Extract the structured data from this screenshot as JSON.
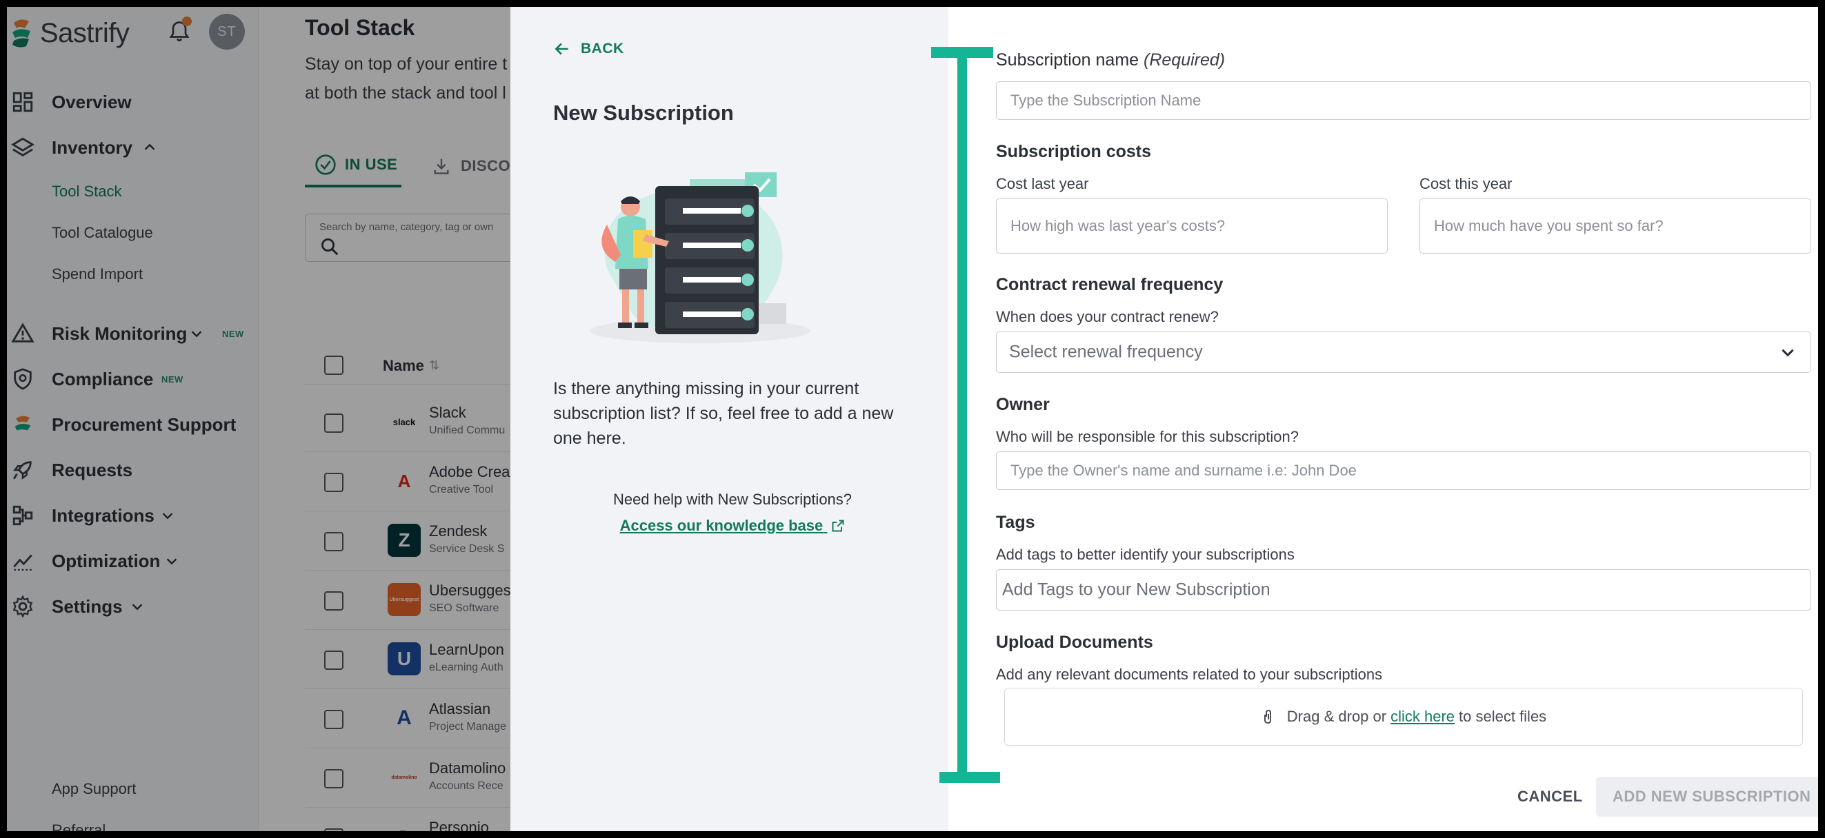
{
  "brand": {
    "name": "Sastrify"
  },
  "user": {
    "initials": "ST"
  },
  "sidebar": {
    "items": [
      {
        "label": "Overview",
        "icon": "dashboard-icon"
      },
      {
        "label": "Inventory",
        "icon": "layers-icon",
        "expanded": true
      },
      {
        "label": "Risk Monitoring",
        "icon": "warning-icon",
        "badge": "NEW"
      },
      {
        "label": "Compliance",
        "icon": "shield-icon",
        "badge": "NEW"
      },
      {
        "label": "Procurement Support",
        "icon": "sastrify-logo-icon"
      },
      {
        "label": "Requests",
        "icon": "rocket-icon"
      },
      {
        "label": "Integrations",
        "icon": "integrations-icon"
      },
      {
        "label": "Optimization",
        "icon": "trend-icon"
      },
      {
        "label": "Settings",
        "icon": "gear-icon"
      }
    ],
    "inventory_sub": [
      "Tool Stack",
      "Tool Catalogue",
      "Spend Import"
    ],
    "footer": [
      "App Support",
      "Referral"
    ]
  },
  "main": {
    "title": "Tool Stack",
    "description_line1": "Stay on top of your entire t",
    "description_line2": "at both the stack and tool l",
    "tabs": [
      {
        "label": "IN USE",
        "icon": "check-circle-icon"
      },
      {
        "label": "DISCO",
        "icon": "download-icon"
      }
    ],
    "search_label": "Search by name, category, tag or own",
    "column_name": "Name",
    "rows": [
      {
        "name": "Slack",
        "category": "Unified Commu",
        "logo_text": "slack",
        "logo_color": "#ffffff"
      },
      {
        "name": "Adobe Crea",
        "category": "Creative Tool",
        "logo_text": "A",
        "logo_color": "#ffffff"
      },
      {
        "name": "Zendesk",
        "category": "Service Desk S",
        "logo_text": "Z",
        "logo_color": "#03363d"
      },
      {
        "name": "Ubersugges",
        "category": "SEO Software",
        "logo_text": "Ubersuggest",
        "logo_color": "#e9672b"
      },
      {
        "name": "LearnUpon",
        "category": "eLearning Auth",
        "logo_text": "U",
        "logo_color": "#1f4fa3"
      },
      {
        "name": "Atlassian",
        "category": "Project Manage",
        "logo_text": "A",
        "logo_color": "#ffffff"
      },
      {
        "name": "Datamolino",
        "category": "Accounts Rece",
        "logo_text": "datamolino",
        "logo_color": "#ffffff"
      },
      {
        "name": "Personio",
        "category": "",
        "logo_text": "P",
        "logo_color": "#ffffff"
      }
    ]
  },
  "drawer": {
    "back_label": "BACK",
    "title": "New Subscription",
    "intro": "Is there anything missing in your current subscription list? If so, feel free to add a new one here.",
    "help_text": "Need help with New Subscriptions?",
    "kb_link": "Access our knowledge base",
    "form": {
      "name_label": "Subscription name",
      "name_required": "(Required)",
      "name_placeholder": "Type the Subscription Name",
      "costs_label": "Subscription costs",
      "cost_last_label": "Cost last year",
      "cost_last_placeholder": "How high was last year's costs?",
      "cost_this_label": "Cost this year",
      "cost_this_placeholder": "How much have you spent so far?",
      "renewal_label": "Contract renewal frequency",
      "renewal_sub": "When does your contract renew?",
      "renewal_placeholder": "Select renewal frequency",
      "owner_label": "Owner",
      "owner_sub": "Who will be responsible for this subscription?",
      "owner_placeholder": "Type the Owner's name and surname i.e: John Doe",
      "tags_label": "Tags",
      "tags_sub": "Add tags to better identify your subscriptions",
      "tags_placeholder": "Add Tags to your New Subscription",
      "upload_label": "Upload Documents",
      "upload_sub": "Add any relevant documents related to your subscriptions",
      "drop_prefix": "Drag & drop or",
      "drop_link": "click here",
      "drop_suffix": "to select files"
    },
    "cancel_label": "CANCEL",
    "submit_label": "ADD NEW SUBSCRIPTION"
  },
  "colors": {
    "accent": "#127a5c",
    "annotation": "#14b595",
    "badge_dot": "#e8823a"
  }
}
